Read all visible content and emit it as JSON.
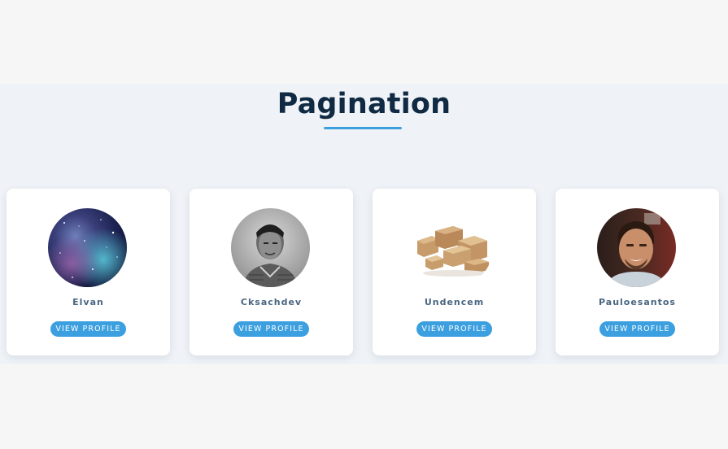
{
  "section": {
    "title": "Pagination",
    "accent_color": "#3b9fe0"
  },
  "cards": [
    {
      "name": "Elvan",
      "button_label": "VIEW PROFILE",
      "avatar": "galaxy-avatar"
    },
    {
      "name": "Cksachdev",
      "button_label": "VIEW PROFILE",
      "avatar": "man-portrait-avatar"
    },
    {
      "name": "Undencem",
      "button_label": "VIEW PROFILE",
      "avatar": "boxes-avatar"
    },
    {
      "name": "Pauloesantos",
      "button_label": "VIEW PROFILE",
      "avatar": "smiling-man-avatar"
    }
  ]
}
